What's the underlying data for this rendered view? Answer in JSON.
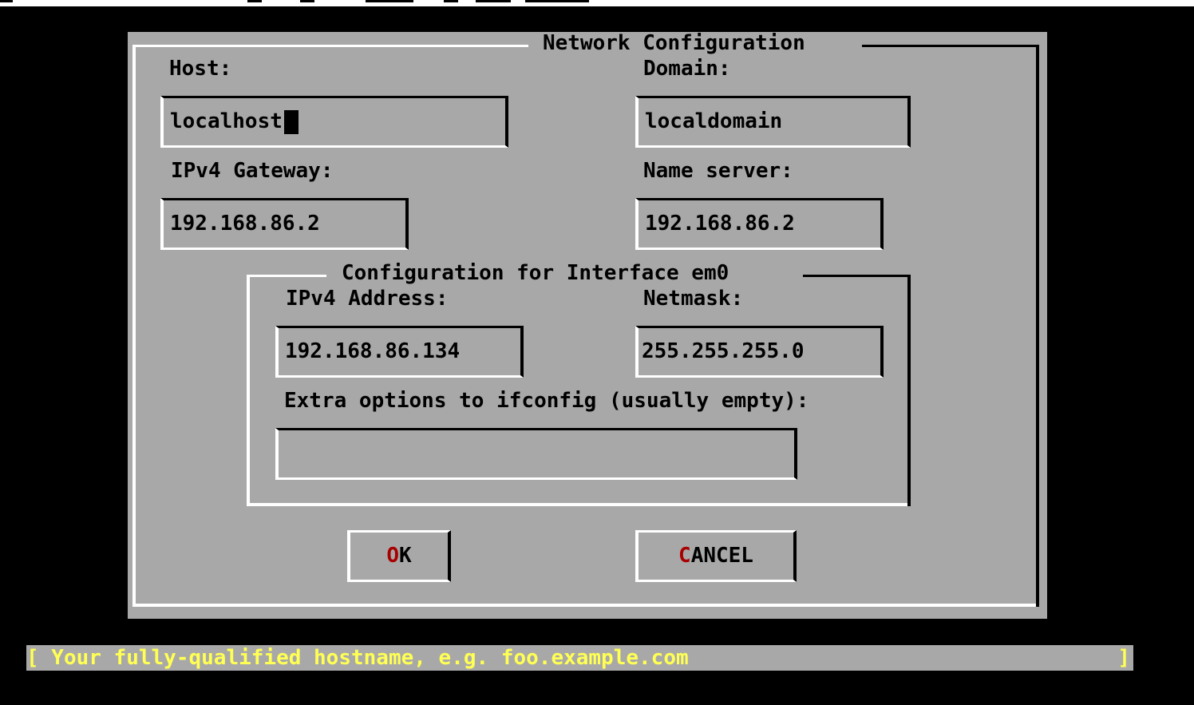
{
  "dialog": {
    "title": "Network Configuration",
    "host_label": "Host:",
    "host_value": "localhost",
    "domain_label": "Domain:",
    "domain_value": "localdomain",
    "gateway_label": "IPv4 Gateway:",
    "gateway_value": "192.168.86.2",
    "nameserver_label": "Name server:",
    "nameserver_value": "192.168.86.2",
    "interface": {
      "title": "Configuration for Interface em0",
      "ipv4_label": "IPv4 Address:",
      "ipv4_value": "192.168.86.134",
      "netmask_label": "Netmask:",
      "netmask_value": "255.255.255.0",
      "extra_label": "Extra options to ifconfig (usually empty):",
      "extra_value": ""
    },
    "buttons": {
      "ok_hotkey": "O",
      "ok_rest": "K",
      "cancel_hotkey": "C",
      "cancel_rest": "ANCEL"
    }
  },
  "status_bar": {
    "text": "[ Your fully-qualified hostname, e.g. foo.example.com",
    "close_bracket": "]"
  },
  "colors": {
    "background": "#000000",
    "dialog": "#a8a8a8",
    "hotkey": "#a80000",
    "status_text": "#ffff54"
  }
}
